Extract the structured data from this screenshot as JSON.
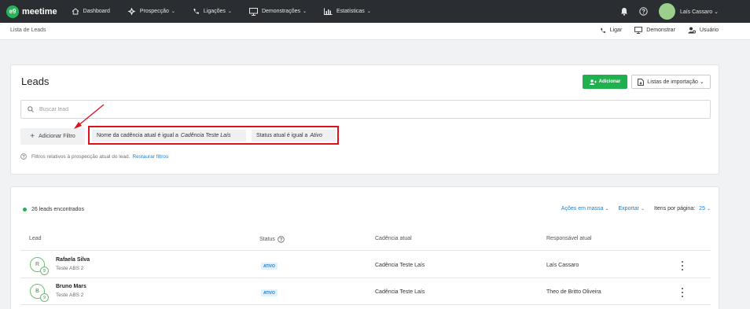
{
  "topbar": {
    "logo_badge": "e9",
    "logo_text": "meetime",
    "nav": [
      {
        "label": "Dashboard",
        "icon": "home-icon",
        "chevron": ""
      },
      {
        "label": "Prospecção",
        "icon": "compass-icon",
        "chevron": "⌄"
      },
      {
        "label": "Ligações",
        "icon": "phone-icon",
        "chevron": "⌄"
      },
      {
        "label": "Demonstrações",
        "icon": "monitor-icon",
        "chevron": "⌄"
      },
      {
        "label": "Estatísticas",
        "icon": "chart-icon",
        "chevron": "⌄"
      }
    ],
    "user_name": "Laís Cassaro ⌄"
  },
  "subbar": {
    "breadcrumb": "Lista de Leads",
    "actions": [
      "Ligar",
      "Demonstrar",
      "Usuário"
    ]
  },
  "filters_card": {
    "title": "Leads",
    "add_label": "Adicionar",
    "import_label": "Listas de importação ⌄",
    "search_placeholder": "Buscar lead",
    "add_filter_label": "Adicionar Filtro",
    "chip1_prefix": "Nome da cadência atual é igual a",
    "chip1_value": "Cadência Teste Laís",
    "chip2_prefix": "Status atual é igual a",
    "chip2_value": "Ativo",
    "hint_text": "Filtros relativos à prospecção atual do lead.",
    "hint_link": "Restaurar filtros"
  },
  "list": {
    "count": "26 leads encontrados",
    "bulk_actions": "Ações em massa",
    "export": "Exportar",
    "per_page_label": "Itens por página:",
    "per_page_value": "25",
    "chev": "⌄",
    "columns": [
      "Lead",
      "Status",
      "Cadência atual",
      "Responsável atual"
    ],
    "rows": [
      {
        "initial": "R",
        "badge": "9",
        "name": "Rafaela Silva",
        "sub": "Teste ABS 2",
        "status": "ATIVO",
        "cadence": "Cadência Teste Laís",
        "owner": "Laís Cassaro"
      },
      {
        "initial": "B",
        "badge": "9",
        "name": "Bruno Mars",
        "sub": "Teste ABS 2",
        "status": "ATIVO",
        "cadence": "Cadência Teste Laís",
        "owner": "Theo de Britto Oliveira"
      }
    ]
  },
  "colors": {
    "topbar": "#2a2d31",
    "accent_green": "#1fb14e",
    "link_blue": "#1a7fcf",
    "highlight_red": "#e0111c"
  }
}
